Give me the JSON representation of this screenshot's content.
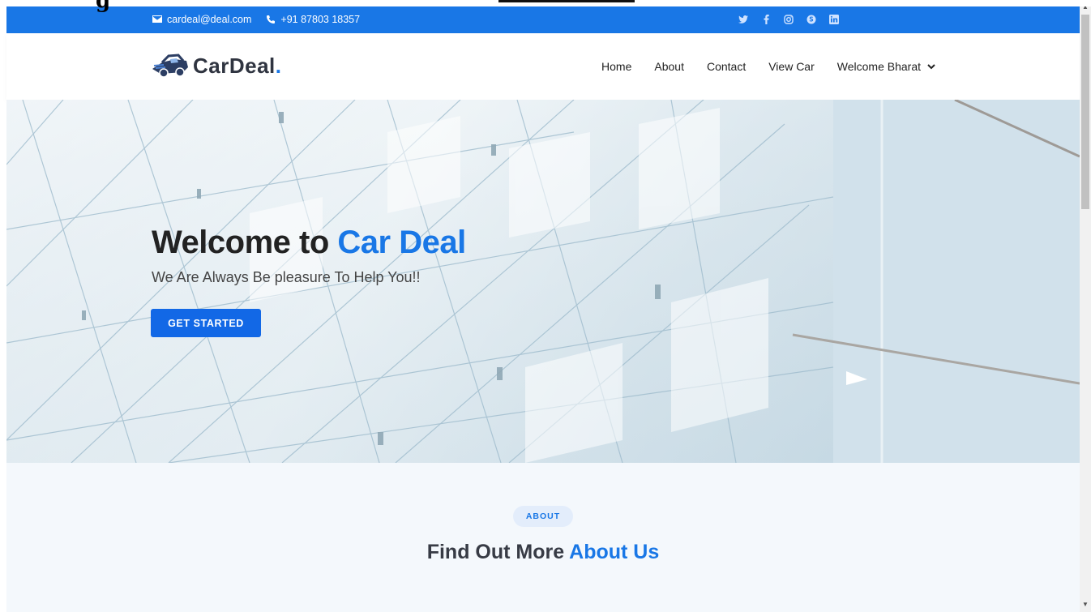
{
  "topbar": {
    "email": "cardeal@deal.com",
    "phone": "+91 87803 18357",
    "social_icons": [
      "twitter-icon",
      "facebook-icon",
      "instagram-icon",
      "skype-icon",
      "linkedin-icon"
    ]
  },
  "header": {
    "logo_text": "CarDeal",
    "logo_dot": ".",
    "nav": {
      "home": "Home",
      "about": "About",
      "contact": "Contact",
      "view_car": "View Car",
      "user": "Welcome Bharat"
    }
  },
  "hero": {
    "title_prefix": "Welcome to ",
    "title_accent": "Car Deal",
    "subtitle": "We Are Always Be pleasure To Help You!!",
    "cta": "GET STARTED"
  },
  "about": {
    "badge": "ABOUT",
    "title_prefix": "Find Out More ",
    "title_accent": "About Us"
  },
  "colors": {
    "accent": "#1977e6",
    "dark_text": "#222222",
    "section_bg": "#f4f8fc"
  }
}
